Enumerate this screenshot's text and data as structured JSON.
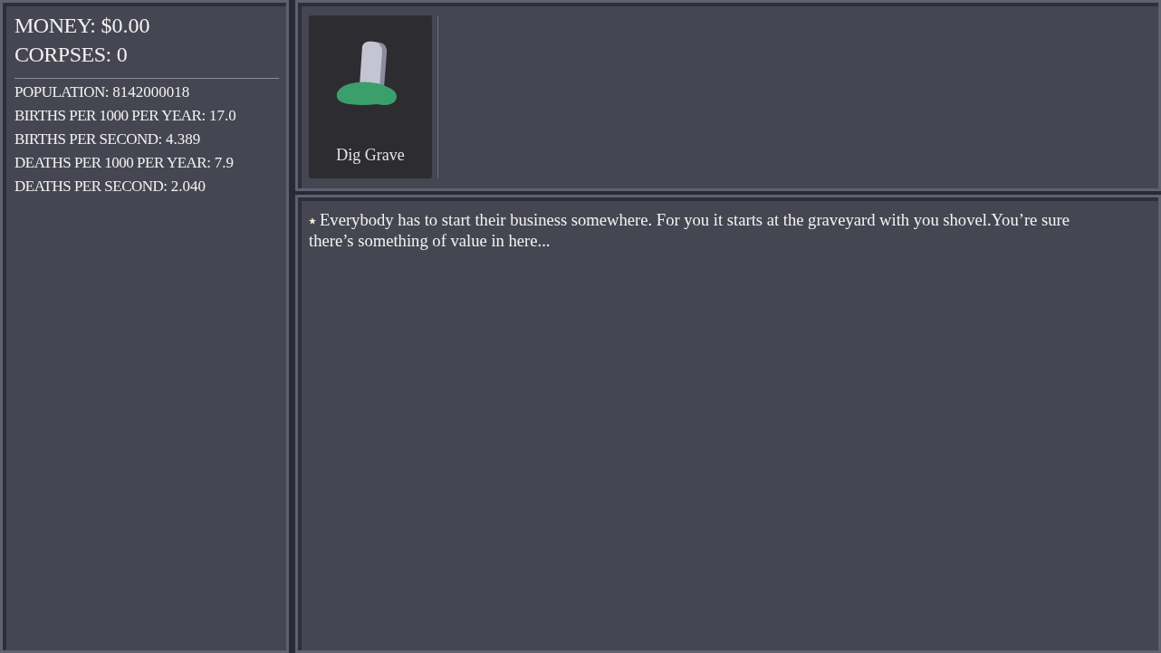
{
  "resources": [
    {
      "label": "MONEY:",
      "value": "$0.00"
    },
    {
      "label": "CORPSES:",
      "value": "0"
    }
  ],
  "stats": [
    {
      "label": "POPULATION:",
      "value": "8142000018"
    },
    {
      "label": "BIRTHS PER 1000 PER YEAR:",
      "value": "17.0"
    },
    {
      "label": "BIRTHS PER SECOND:",
      "value": "4.389"
    },
    {
      "label": "DEATHS PER 1000 PER YEAR:",
      "value": "7.9"
    },
    {
      "label": "DEATHS PER SECOND:",
      "value": "2.040"
    }
  ],
  "actions": [
    {
      "label": "Dig Grave"
    }
  ],
  "log": [
    {
      "text": "Everybody has to start their business somewhere. For you it starts at the graveyard with you shovel.You’re sure there’s something of value in here..."
    }
  ]
}
